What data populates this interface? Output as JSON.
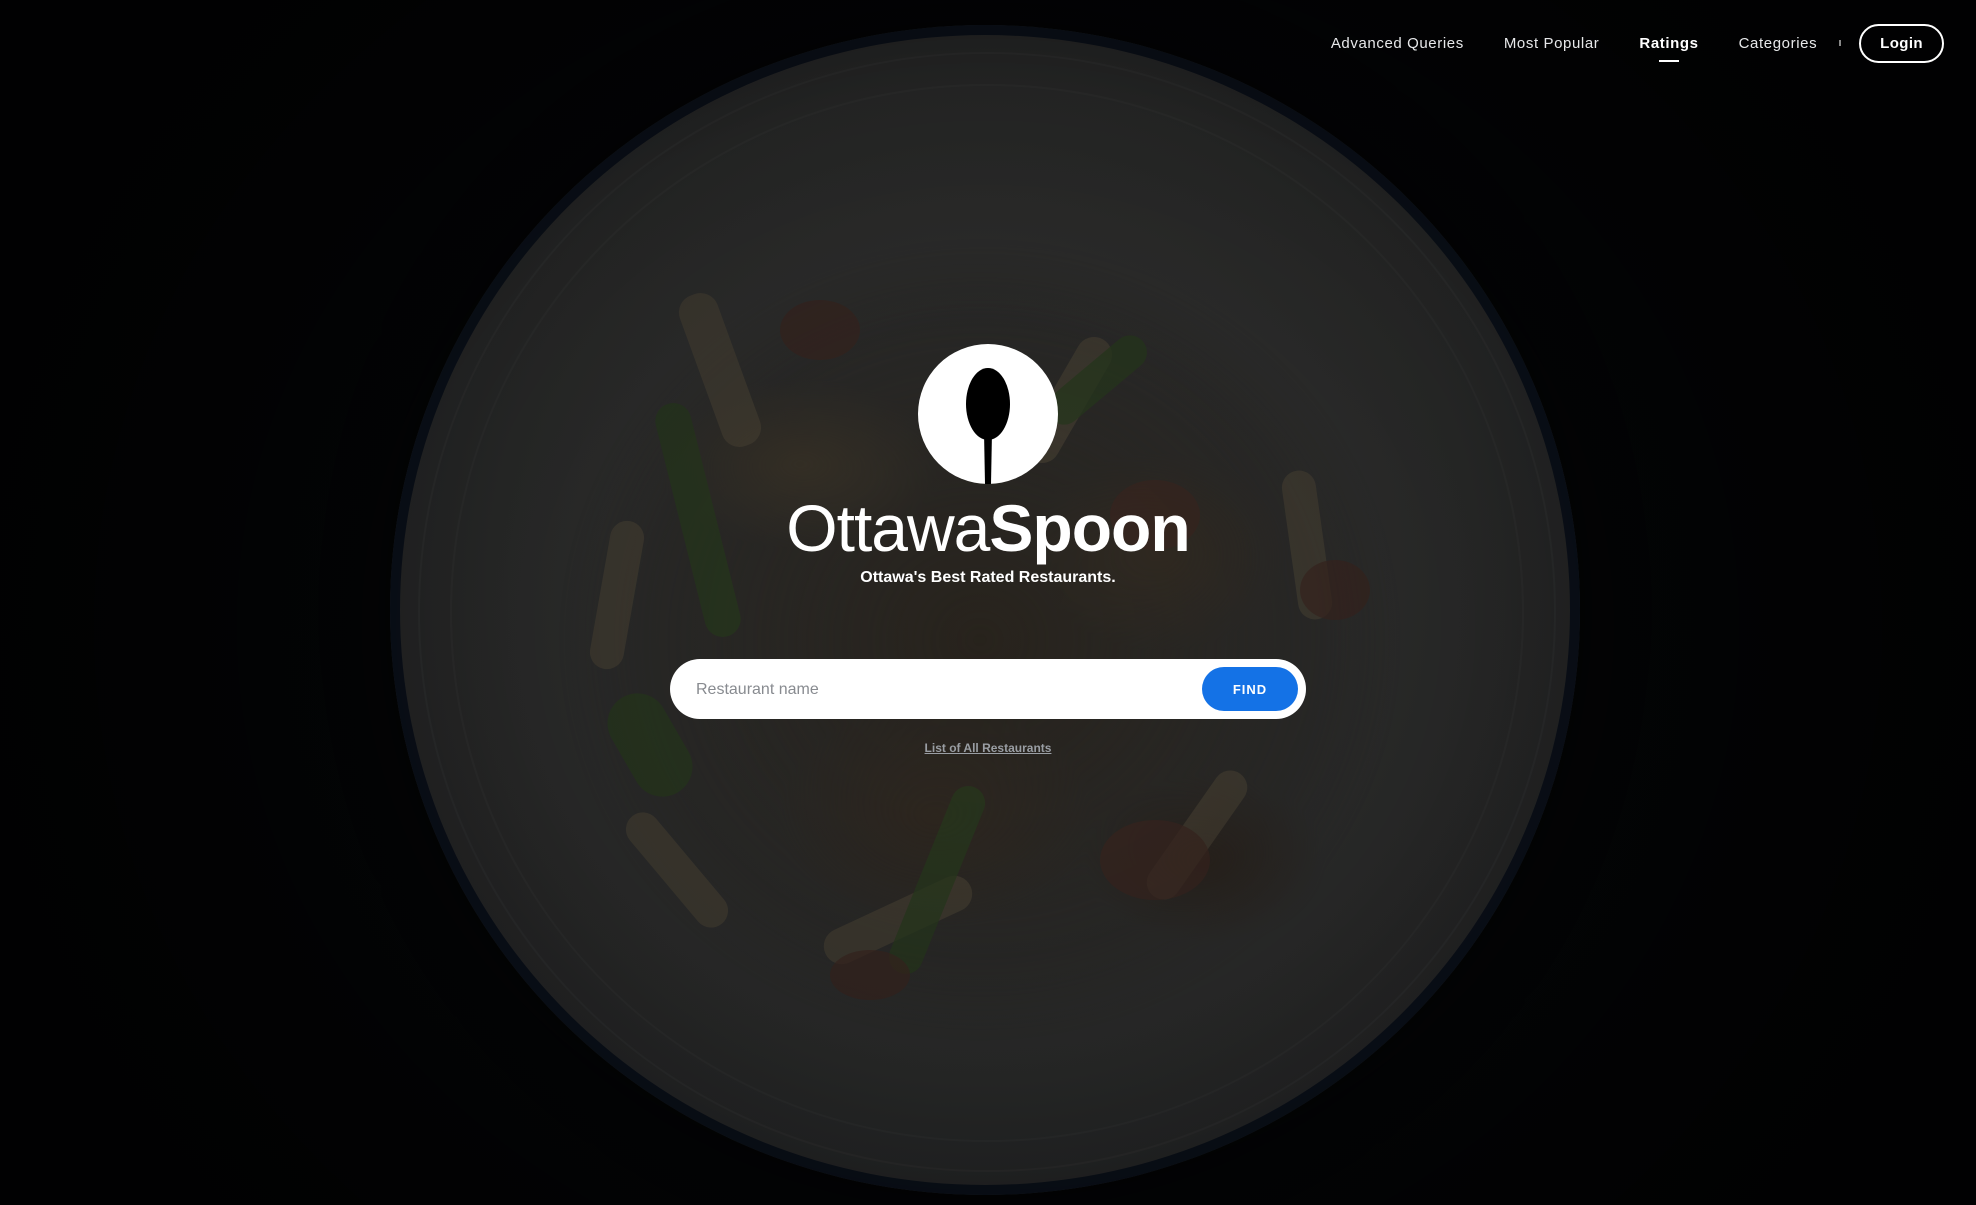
{
  "nav": {
    "items": [
      {
        "label": "Advanced Queries",
        "active": false
      },
      {
        "label": "Most Popular",
        "active": false
      },
      {
        "label": "Ratings",
        "active": true
      },
      {
        "label": "Categories",
        "active": false
      }
    ],
    "login_label": "Login"
  },
  "hero": {
    "logo_icon": "spoon-icon",
    "brand_light": "Ottawa",
    "brand_bold": "Spoon",
    "tagline": "Ottawa's Best Rated Restaurants."
  },
  "search": {
    "placeholder": "Restaurant name",
    "value": "",
    "button_label": "FIND"
  },
  "links": {
    "all_restaurants": "List of All Restaurants"
  },
  "colors": {
    "accent": "#1472e6",
    "background": "#050608",
    "text": "#ffffff"
  }
}
